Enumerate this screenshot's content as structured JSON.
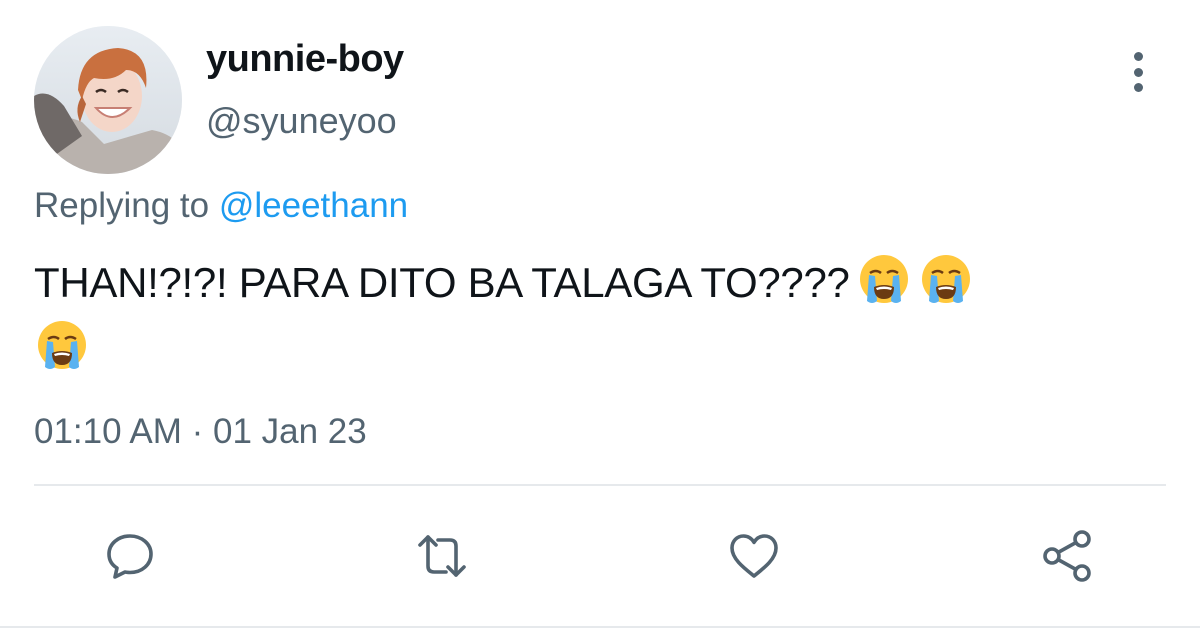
{
  "tweet": {
    "display_name": "yunnie-boy",
    "handle": "@syuneyoo",
    "replying_prefix": "Replying to",
    "replying_to": "@leeethann",
    "text": "THAN!?!?! PARA DITO BA TALAGA TO????",
    "emojis": [
      "loudly-crying-face",
      "loudly-crying-face",
      "loudly-crying-face"
    ],
    "timestamp": "01:10 AM · 01 Jan 23"
  },
  "actions": {
    "icons": [
      "reply-icon",
      "retweet-icon",
      "like-icon",
      "share-icon"
    ]
  },
  "colors": {
    "text_primary": "#0f1419",
    "text_secondary": "#536471",
    "mention_blue": "#1d9bf0",
    "divider": "#e6e9ec"
  }
}
